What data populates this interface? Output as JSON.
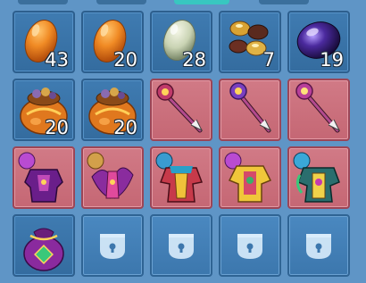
{
  "inventory": {
    "slots": [
      {
        "item": "orange-egg-icon",
        "count": "43",
        "bg": "blue"
      },
      {
        "item": "orange-egg-icon",
        "count": "20",
        "bg": "blue"
      },
      {
        "item": "jade-egg-icon",
        "count": "28",
        "bg": "blue"
      },
      {
        "item": "gold-ore-icon",
        "count": "7",
        "bg": "blue"
      },
      {
        "item": "purple-gem-icon",
        "count": "19",
        "bg": "blue"
      },
      {
        "item": "treasure-bag-icon",
        "count": "20",
        "bg": "blue"
      },
      {
        "item": "treasure-bag-icon",
        "count": "20",
        "bg": "blue"
      },
      {
        "item": "magic-staff-icon",
        "count": "",
        "bg": "red"
      },
      {
        "item": "magic-staff-icon",
        "count": "",
        "bg": "red"
      },
      {
        "item": "magic-staff-icon",
        "count": "",
        "bg": "red"
      },
      {
        "item": "dark-armor-icon",
        "count": "",
        "bg": "red"
      },
      {
        "item": "winged-armor-icon",
        "count": "",
        "bg": "red"
      },
      {
        "item": "festive-robe-icon",
        "count": "",
        "bg": "red"
      },
      {
        "item": "golden-armor-icon",
        "count": "",
        "bg": "red"
      },
      {
        "item": "jeweled-robe-icon",
        "count": "",
        "bg": "red"
      },
      {
        "item": "purple-pouch-icon",
        "count": "",
        "bg": "blue"
      },
      {
        "item": "locked-slot-icon",
        "count": "",
        "bg": "locked"
      },
      {
        "item": "locked-slot-icon",
        "count": "",
        "bg": "locked"
      },
      {
        "item": "locked-slot-icon",
        "count": "",
        "bg": "locked"
      },
      {
        "item": "locked-slot-icon",
        "count": "",
        "bg": "locked"
      }
    ]
  },
  "colors": {
    "background": "#5f95c6",
    "slot_blue": "#3a74a8",
    "slot_red": "#cc7280",
    "active_tab": "#38c7c0"
  }
}
